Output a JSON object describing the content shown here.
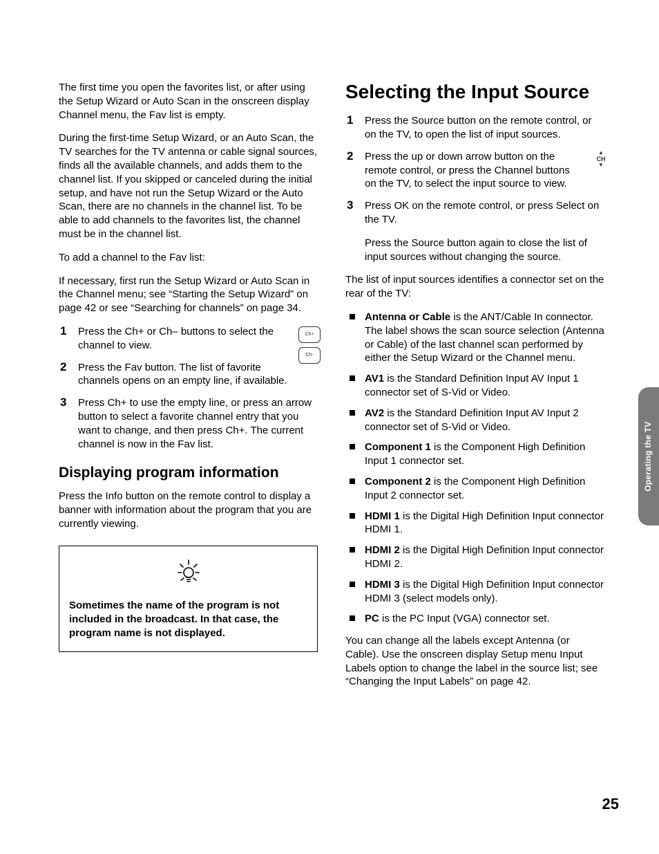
{
  "sideTab": "Operating the TV",
  "pageNumber": "25",
  "left": {
    "p1": "The first time you open the favorites list, or after using the Setup Wizard or Auto Scan in the onscreen display Channel menu, the Fav list is empty.",
    "p2": "During the first-time Setup Wizard, or an Auto Scan, the TV searches for the TV antenna or cable signal sources, finds all the available channels, and adds them to the channel list. If you skipped or canceled during the initial setup, and have not run the Setup Wizard or the Auto Scan, there are no channels in the channel list. To be able to add channels to the favorites list, the channel must be in the channel list.",
    "p3": "To add a channel to the Fav list:",
    "p4": "If necessary, first run the Setup Wizard or Auto Scan in the Channel menu; see “Starting the Setup Wizard” on page 42 or see “Searching for channels” on page 34.",
    "steps": [
      "Press the Ch+ or Ch– buttons to select the channel to view.",
      "Press the Fav button. The list of favorite channels opens on an empty line, if available.",
      "Press Ch+ to use the empty line, or press an arrow button to select a favorite channel entry that you want to change, and then press Ch+. The current channel is now in the Fav list."
    ],
    "chPlus": "Ch+",
    "chMinus": "Ch-",
    "h2": "Displaying program information",
    "p5": "Press the Info button on the remote control to display a banner with information about the program that you are currently viewing.",
    "note": "Sometimes the name of the program is not included in the broadcast. In that case, the program name is not displayed."
  },
  "right": {
    "h1": "Selecting the Input Source",
    "steps": [
      "Press the Source button on the remote control, or on the TV, to open the list of input sources.",
      "Press the up or down arrow button on the remote control, or press the Channel buttons on the TV, to select the input source to view.",
      "Press OK on the remote control, or press Select on the TV."
    ],
    "chLabel": "CH",
    "afterSteps": "Press the Source button again to close the list of input sources without changing the source.",
    "p1": "The list of input sources identifies a connector set on the rear of the TV:",
    "bullets": [
      {
        "b": "Antenna or Cable",
        "t": " is the ANT/Cable In connector. The label shows the scan source selection (Antenna or Cable) of the last channel scan performed by either the Setup Wizard or the Channel menu."
      },
      {
        "b": "AV1",
        "t": " is the Standard Definition Input AV Input 1 connector set of S-Vid or Video."
      },
      {
        "b": "AV2",
        "t": " is the Standard Definition Input AV Input 2 connector set of S-Vid or Video."
      },
      {
        "b": "Component 1",
        "t": " is the Component High Definition Input 1 connector set."
      },
      {
        "b": "Component 2",
        "t": " is the Component High Definition Input 2 connector set."
      },
      {
        "b": "HDMI 1",
        "t": " is the Digital High Definition Input connector HDMI 1."
      },
      {
        "b": "HDMI 2",
        "t": " is the Digital High Definition Input connector HDMI 2."
      },
      {
        "b": "HDMI 3",
        "t": " is the Digital High Definition Input connector HDMI 3 (select models only)."
      },
      {
        "b": "PC",
        "t": " is the PC Input (VGA) connector set."
      }
    ],
    "p2": "You can change all the labels except Antenna (or Cable). Use the onscreen display Setup menu Input Labels option to change the label in the source list; see “Changing the Input Labels” on page 42."
  }
}
